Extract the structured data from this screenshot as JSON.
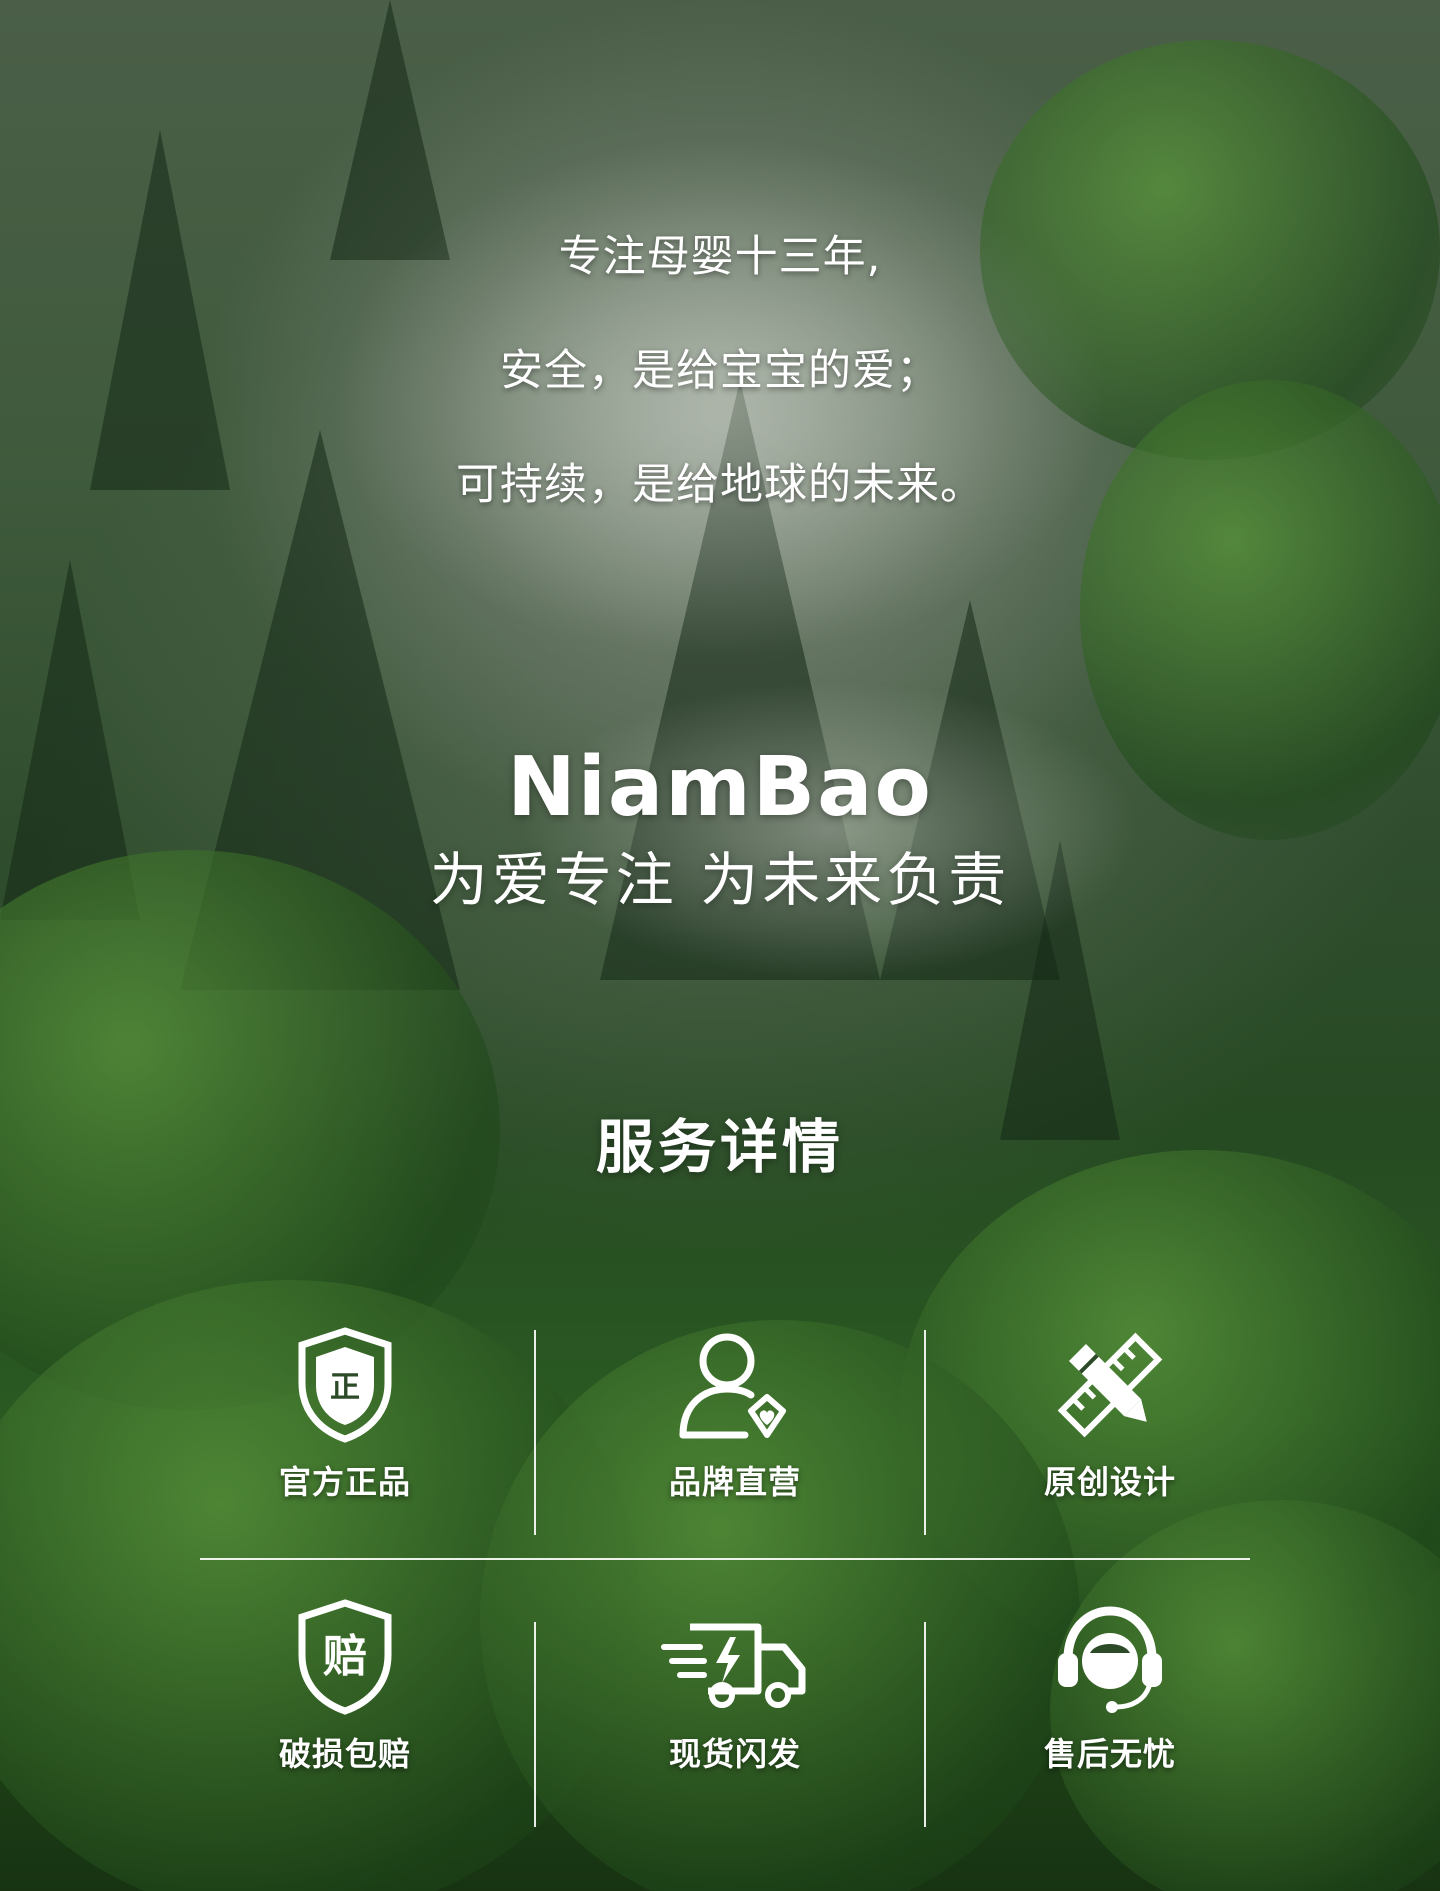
{
  "intro": {
    "line1": "专注母婴十三年,",
    "line2": "安全，是给宝宝的爱；",
    "line3": "可持续，是给地球的未来。"
  },
  "brand": {
    "logo": "NiamBao",
    "slogan": "为爱专注  为未来负责"
  },
  "services": {
    "title": "服务详情",
    "items": [
      {
        "label": "官方正品",
        "icon": "shield-authentic-icon",
        "badge": "正"
      },
      {
        "label": "品牌直营",
        "icon": "user-heart-icon"
      },
      {
        "label": "原创设计",
        "icon": "ruler-pencil-icon"
      },
      {
        "label": "破损包赔",
        "icon": "shield-compensation-icon",
        "badge": "赔"
      },
      {
        "label": "现货闪发",
        "icon": "fast-truck-icon"
      },
      {
        "label": "售后无忧",
        "icon": "headset-support-icon"
      }
    ]
  }
}
